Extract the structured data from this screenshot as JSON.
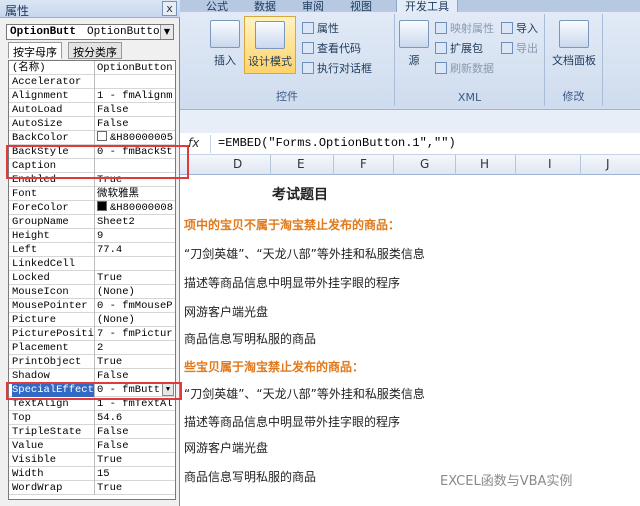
{
  "ribbon": {
    "tabs": [
      "公式",
      "数据",
      "审阅",
      "视图",
      "开发工具"
    ],
    "controls_group": {
      "label": "控件",
      "insert": "插入",
      "design_mode": "设计模式",
      "properties": "属性",
      "view_code": "查看代码",
      "run_dialog": "执行对话框"
    },
    "xml_group": {
      "label": "XML",
      "source": "源",
      "map_props": "映射属性",
      "expansion": "扩展包",
      "refresh": "刷新数据",
      "import": "导入",
      "export": "导出"
    },
    "modify_group": {
      "label": "修改",
      "doc_panel": "文档面板"
    }
  },
  "formula_bar": {
    "fx": "fx",
    "formula": "=EMBED(\"Forms.OptionButton.1\",\"\")"
  },
  "columns": [
    "D",
    "E",
    "F",
    "G",
    "H",
    "I",
    "J"
  ],
  "sheet": {
    "title": "考试题目",
    "q1": "项中的宝贝不属于淘宝禁止发布的商品：",
    "q1_items": [
      "“刀剑英雄”、“天龙八部”等外挂和私服类信息",
      "描述等商品信息中明显带外挂字眼的程序",
      "网游客户端光盘",
      "商品信息写明私服的商品"
    ],
    "q2": "些宝贝属于淘宝禁止发布的商品：",
    "q2_items": [
      "“刀剑英雄”、“天龙八部”等外挂和私服类信息",
      "描述等商品信息中明显带外挂字眼的程序",
      "网游客户端光盘",
      "商品信息写明私服的商品"
    ],
    "watermark": "EXCEL函数与VBA实例"
  },
  "panel": {
    "title": "属性",
    "close": "x",
    "combo_name": "OptionButt",
    "combo_type": "OptionButto",
    "tab_alpha": "按字母序",
    "tab_cat": "按分类序",
    "props": [
      {
        "name": "(名称)",
        "value": "OptionButton"
      },
      {
        "name": "Accelerator",
        "value": ""
      },
      {
        "name": "Alignment",
        "value": "1 - fmAlignm"
      },
      {
        "name": "AutoLoad",
        "value": "False"
      },
      {
        "name": "AutoSize",
        "value": "False"
      },
      {
        "name": "BackColor",
        "value": "&H80000005",
        "swatch": "#ffffff"
      },
      {
        "name": "BackStyle",
        "value": "0 - fmBackSt"
      },
      {
        "name": "Caption",
        "value": ""
      },
      {
        "name": "Enabled",
        "value": "True"
      },
      {
        "name": "Font",
        "value": "微软雅黑"
      },
      {
        "name": "ForeColor",
        "value": "&H80000008",
        "swatch": "#000000"
      },
      {
        "name": "GroupName",
        "value": "Sheet2"
      },
      {
        "name": "Height",
        "value": "9"
      },
      {
        "name": "Left",
        "value": "77.4"
      },
      {
        "name": "LinkedCell",
        "value": ""
      },
      {
        "name": "Locked",
        "value": "True"
      },
      {
        "name": "MouseIcon",
        "value": "(None)"
      },
      {
        "name": "MousePointer",
        "value": "0 - fmMouseP"
      },
      {
        "name": "Picture",
        "value": "(None)"
      },
      {
        "name": "PicturePositi",
        "value": "7 - fmPictur"
      },
      {
        "name": "Placement",
        "value": "2"
      },
      {
        "name": "PrintObject",
        "value": "True"
      },
      {
        "name": "Shadow",
        "value": "False"
      },
      {
        "name": "SpecialEffect",
        "value": "0 - fmButt",
        "selected": true
      },
      {
        "name": "TextAlign",
        "value": "1 - fmTextAl"
      },
      {
        "name": "Top",
        "value": "54.6"
      },
      {
        "name": "TripleState",
        "value": "False"
      },
      {
        "name": "Value",
        "value": "False"
      },
      {
        "name": "Visible",
        "value": "True"
      },
      {
        "name": "Width",
        "value": "15"
      },
      {
        "name": "WordWrap",
        "value": "True"
      }
    ]
  },
  "colors": {
    "highlight_box": "#e23a3a",
    "selection": "#316ac5",
    "section_heading": "#e07a1d"
  }
}
